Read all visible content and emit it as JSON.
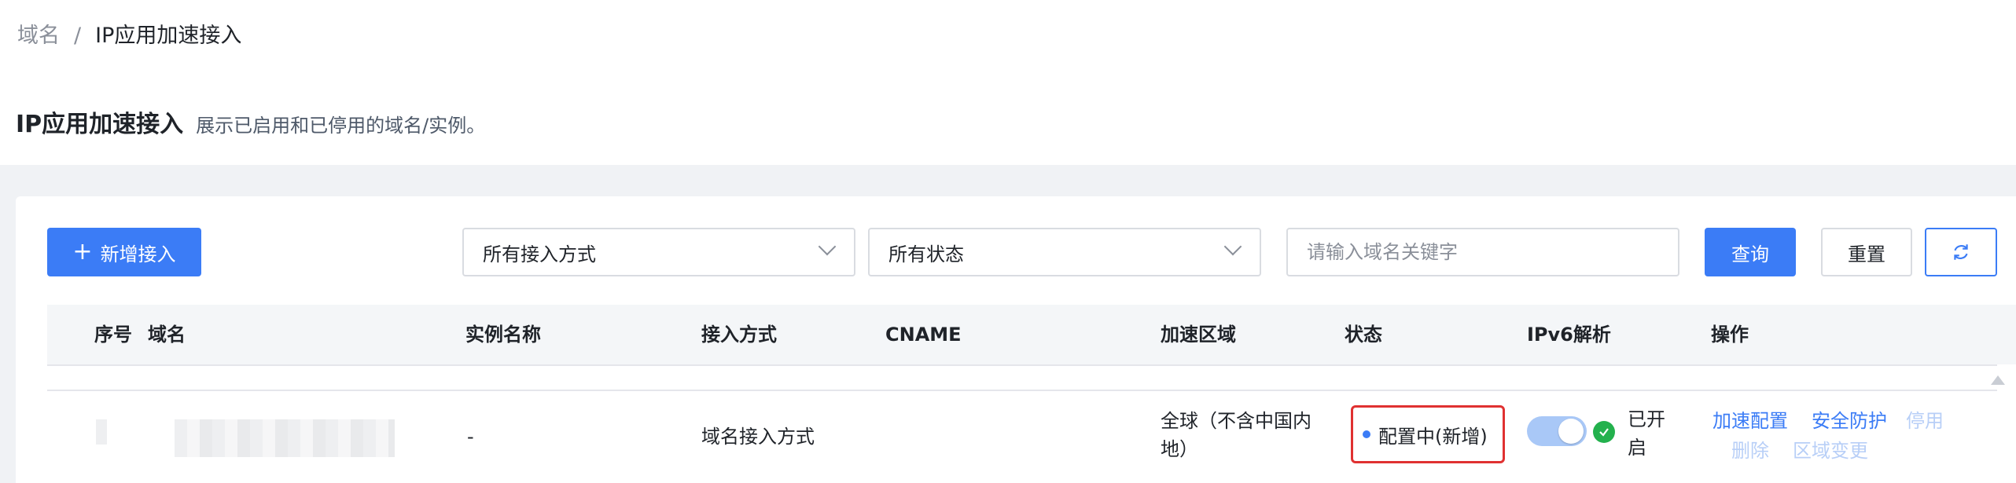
{
  "breadcrumb": {
    "parent": "域名",
    "separator": "/",
    "current": "IP应用加速接入"
  },
  "header": {
    "title": "IP应用加速接入",
    "description": "展示已启用和已停用的域名/实例。"
  },
  "toolbar": {
    "new_button": "新增接入",
    "access_select": "所有接入方式",
    "status_select": "所有状态",
    "search_placeholder": "请输入域名关键字",
    "search_value": "",
    "query_button": "查询",
    "reset_button": "重置"
  },
  "table": {
    "columns": [
      "序号",
      "域名",
      "实例名称",
      "接入方式",
      "CNAME",
      "加速区域",
      "状态",
      "IPv6解析",
      "操作"
    ],
    "rows": [
      {
        "index": "",
        "domain": "",
        "instance": "-",
        "access": "域名接入方式",
        "cname": "",
        "region": "全球（不含中国内地）",
        "status": "配置中(新增)",
        "ipv6": "已开启",
        "actions": {
          "accel_config": "加速配置",
          "security": "安全防护",
          "disable": "停用",
          "delete": "删除",
          "region_change": "区域变更"
        }
      }
    ]
  },
  "colors": {
    "primary": "#3b7cf6",
    "danger_outline": "#e03131",
    "success": "#23b14d"
  }
}
